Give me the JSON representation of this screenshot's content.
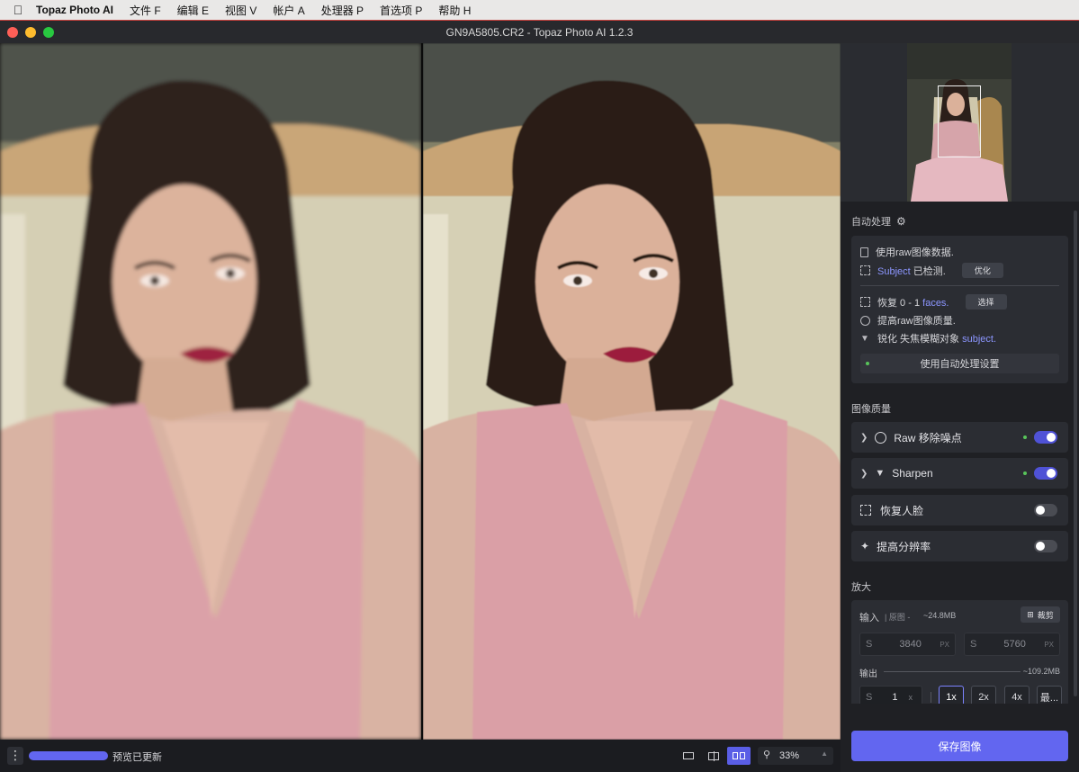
{
  "menubar": {
    "app_name": "Topaz Photo AI",
    "items": [
      "文件 F",
      "编辑 E",
      "视图 V",
      "帐户 A",
      "处理器 P",
      "首选项 P",
      "帮助 H"
    ]
  },
  "window": {
    "title": "GN9A5805.CR2 - Topaz Photo AI 1.2.3"
  },
  "autopilot": {
    "title": "自动处理",
    "line_raw": "使用raw图像数据.",
    "subject_word": "Subject",
    "subject_rest": "已检测.",
    "refine_label": "优化",
    "faces_prefix": "恢复 0 - 1",
    "faces_word": "faces.",
    "select_label": "选择",
    "raw_quality": "提高raw图像质量.",
    "sharpen_prefix": "锐化 失焦模糊对象",
    "sharpen_word": "subject.",
    "apply_label": "使用自动处理设置"
  },
  "image_quality": {
    "title": "图像质量",
    "rows": [
      {
        "label": "Raw 移除噪点",
        "enabled": true
      },
      {
        "label": "Sharpen",
        "enabled": true
      },
      {
        "label": "恢复人脸",
        "enabled": false
      },
      {
        "label": "提高分辨率",
        "enabled": false
      }
    ]
  },
  "upscale": {
    "title": "放大",
    "input_label": "输入",
    "input_source": "| 原图 -",
    "input_size": "~24.8MB",
    "crop_label": "裁剪",
    "width_prefix": "S",
    "width_value": "3840",
    "height_prefix": "S",
    "height_value": "5760",
    "unit": "PX",
    "output_label": "输出",
    "output_size": "~109.2MB",
    "scale_prefix": "S",
    "scale_value": "1",
    "scale_suffix": "x",
    "scale_options": [
      "1x",
      "2x",
      "4x",
      "最..."
    ],
    "selected_scale": "1x"
  },
  "bottom": {
    "status": "预览已更新",
    "zoom": "33%",
    "progress": 1.0,
    "view_modes": [
      "single",
      "split",
      "side-by-side"
    ],
    "active_view": "side-by-side"
  },
  "save_label": "保存图像",
  "colors": {
    "accent": "#6266f0",
    "toggle_on": "#4f52d6",
    "status_dot": "#58c45a",
    "highlight_text": "#8c96ff"
  }
}
